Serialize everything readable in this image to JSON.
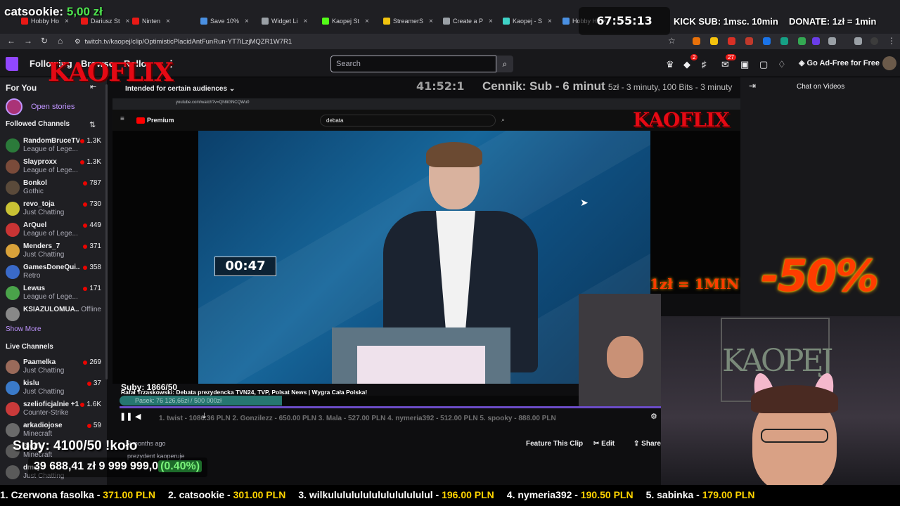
{
  "browser": {
    "tabs": [
      {
        "label": "Hobby Ho",
        "color": "#e91916"
      },
      {
        "label": "Dariusz St",
        "color": "#e91916"
      },
      {
        "label": "Ninten",
        "color": "#e91916"
      },
      {
        "label": "Save 10%",
        "color": "#4a90e2"
      },
      {
        "label": "Widget Li",
        "color": "#9aa0a6"
      },
      {
        "label": "Kaopej St",
        "color": "#53fc18"
      },
      {
        "label": "StreamerS",
        "color": "#f1c40f"
      },
      {
        "label": "Create a P",
        "color": "#9aa0a6"
      },
      {
        "label": "Kaopej - S",
        "color": "#3fd3c7"
      },
      {
        "label": "Hobby H",
        "color": "#4a90e2"
      }
    ],
    "url": "twitch.tv/kaopej/clip/OptimisticPlacidAntFunRun-YT7iLzjMQZR1W7R1"
  },
  "twitch": {
    "nav": {
      "following": "Following",
      "browse": "Browse",
      "rollo": "Rollo"
    },
    "search_placeholder": "Search",
    "notif_badge": "27",
    "bits_badge": "2",
    "ad_free": "Go Ad-Free for Free",
    "sidebar": {
      "for_you": "For You",
      "open_stories": "Open stories",
      "followed_title": "Followed Channels",
      "followed": [
        {
          "name": "RandomBruceTV",
          "game": "League of Lege...",
          "viewers": "1.3K",
          "color": "#2b7a3a"
        },
        {
          "name": "Slayproxx",
          "game": "League of Lege...",
          "viewers": "1.3K",
          "color": "#7a4b3a"
        },
        {
          "name": "Bonkol",
          "game": "Gothic",
          "viewers": "787",
          "color": "#5a4a3a"
        },
        {
          "name": "revo_toja",
          "game": "Just Chatting",
          "viewers": "730",
          "color": "#c9c234"
        },
        {
          "name": "ArQuel",
          "game": "League of Lege...",
          "viewers": "449",
          "color": "#c93434"
        },
        {
          "name": "Menders_7",
          "game": "Just Chatting",
          "viewers": "371",
          "color": "#d9a23a"
        },
        {
          "name": "GamesDoneQui...",
          "game": "Retro",
          "viewers": "358",
          "color": "#3a6ac9"
        },
        {
          "name": "Lewus",
          "game": "League of Lege...",
          "viewers": "171",
          "color": "#4aa34a"
        },
        {
          "name": "KSIAZULOMUA...",
          "game": "",
          "viewers": "Offline",
          "color": "#888888"
        }
      ],
      "show_more": "Show More",
      "live_title": "Live Channels",
      "live": [
        {
          "name": "Paamelka",
          "game": "Just Chatting",
          "viewers": "269",
          "color": "#9a6a5a"
        },
        {
          "name": "kislu",
          "game": "Just Chatting",
          "viewers": "37",
          "color": "#3a7ac9"
        },
        {
          "name": "szelioficjalnie +1",
          "game": "Counter-Strike",
          "viewers": "1.6K",
          "color": "#c93a3a"
        },
        {
          "name": "arkadiojose",
          "game": "Minecraft",
          "viewers": "59",
          "color": "#6a6a6a"
        },
        {
          "name": "Sadfo",
          "game": "Minecraft",
          "viewers": "",
          "color": "#5a5a5a"
        },
        {
          "name": "dmaj",
          "game": "Just Chatting",
          "viewers": "",
          "color": "#5a5a5a"
        }
      ]
    },
    "clip": {
      "audience": "Intended for certain audiences",
      "inner_url": "youtube.com/watch?v=Qh8iGNCQWu0",
      "yt_premium": "Premium",
      "yt_search": "debata",
      "debate_timer": "00:47",
      "video_title": "Rafał Trzaskowski: Debata prezydencka TVN24, TVP, Polsat News | Wygra Cała Polska!",
      "age": "9 months ago",
      "clipped_by": "prezydent kaoperuje",
      "feature_btn": "Feature This Clip",
      "edit_btn": "Edit",
      "share_btn": "Share"
    },
    "chat": {
      "title": "Chat on Videos"
    }
  },
  "overlay": {
    "top_donor_name": "catsookie:",
    "top_donor_amount": "5,00 zł",
    "timer": "67:55:13",
    "kick_sub": "KICK SUB: 1msc. 10min",
    "donate": "DONATE: 1zł = 1min",
    "kaoflix": "KAOFLIX",
    "timer2": "41:52:1",
    "cennik_head": "Cennik: Sub - 6 minut",
    "cennik_rest": "5zł - 3 minuty, 100 Bits - 3 minuty",
    "subs_goal": "Suby: 1866/50",
    "goal_text": "Pasek: 76 126,66zł / 500 000zł",
    "goal_fraction": 0.3,
    "top_list": "1. twist - 1086.36 PLN   2. Gonzilezz - 650.00 PLN   3. Mala - 527.00 PLN   4. nymeria392 - 512.00 PLN   5. spooky - 888.00 PLN",
    "suby_big": "Suby: 4100/50 !koło",
    "money_total": "39 688,41 zł",
    "money_goal": "9 999 999,0",
    "money_pct": "(0.40%)",
    "one_min": "1zł = 1MIN",
    "discount": "-50%",
    "cam_wall": "KAOPEJ",
    "ticker": [
      {
        "name": "1. Czerwona fasolka - ",
        "value": "371.00 PLN"
      },
      {
        "name": "2. catsookie - ",
        "value": "301.00 PLN"
      },
      {
        "name": "3. wilkulululululululululululul - ",
        "value": "196.00 PLN"
      },
      {
        "name": "4. nymeria392 - ",
        "value": "190.50 PLN"
      },
      {
        "name": "5. sabinka - ",
        "value": "179.00 PLN"
      }
    ]
  }
}
